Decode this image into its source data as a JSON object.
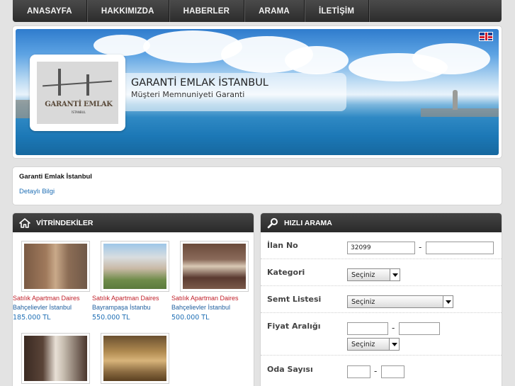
{
  "nav": {
    "items": [
      "ANASAYFA",
      "HAKKIMIZDA",
      "HABERLER",
      "ARAMA",
      "İLETİŞİM"
    ]
  },
  "header": {
    "site_title": "GARANTİ EMLAK İSTANBUL",
    "site_subtitle": "Müşteri Memnuniyeti Garanti",
    "logo_text": "GARANTİ EMLAK",
    "logo_subtext": "İSTANBUL",
    "language_flag": "uk-flag-icon"
  },
  "info": {
    "title": "Garanti Emlak İstanbul",
    "link": "Detaylı Bilgi"
  },
  "vitrin": {
    "heading": "VİTRİNDEKİLER",
    "icon": "home-icon",
    "listings": [
      {
        "title": "Satılık Apartman Daires",
        "location": "Bahçelievler İstanbul",
        "price": "185.000 TL",
        "photo": "building-photo"
      },
      {
        "title": "Satılık Apartman Daires",
        "location": "Bayrampaşa İstanbu",
        "price": "550.000 TL",
        "photo": "complex-photo"
      },
      {
        "title": "Satılık Apartman Daires",
        "location": "Bahçelievler İstanbul",
        "price": "500.000 TL",
        "photo": "living-room-photo"
      },
      {
        "title": "",
        "location": "",
        "price": "",
        "photo": "hallway-photo"
      },
      {
        "title": "",
        "location": "",
        "price": "",
        "photo": "kitchen-photo"
      }
    ]
  },
  "search": {
    "heading": "HIZLI ARAMA",
    "icon": "magnifier-icon",
    "ilan_no_label": "İlan No",
    "ilan_no_value": "32099",
    "kategori_label": "Kategori",
    "kategori_value": "Seçiniz",
    "semt_label": "Semt Listesi",
    "semt_value": "Seçiniz",
    "fiyat_label": "Fiyat Aralığı",
    "fiyat_currency_value": "Seçiniz",
    "oda_label": "Oda Sayısı",
    "dash": "-"
  },
  "colors": {
    "nav_bg": "#333333",
    "listing_title": "#c0202a",
    "link_blue": "#1f6fb5"
  }
}
